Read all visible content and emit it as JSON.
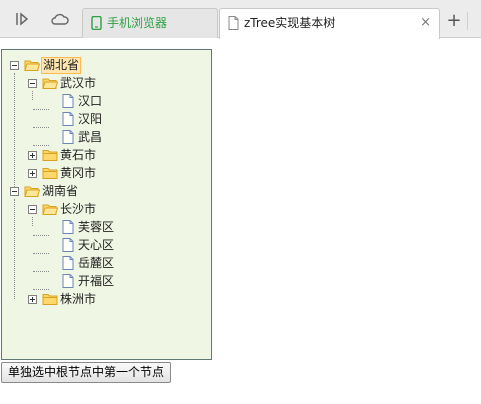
{
  "browser": {
    "tabs": [
      {
        "label": "手机浏览器",
        "icon": "phone-icon",
        "color": "#2ea043"
      },
      {
        "label": "zTree实现基本树",
        "icon": "page-icon",
        "close": "×"
      }
    ],
    "add_tab": "+"
  },
  "tree": {
    "nodes": [
      {
        "label": "湖北省",
        "type": "folder",
        "open": true,
        "selected": true
      },
      {
        "label": "武汉市",
        "type": "folder",
        "open": true
      },
      {
        "label": "汉口",
        "type": "file"
      },
      {
        "label": "汉阳",
        "type": "file"
      },
      {
        "label": "武昌",
        "type": "file"
      },
      {
        "label": "黄石市",
        "type": "folder",
        "open": false
      },
      {
        "label": "黄冈市",
        "type": "folder",
        "open": false
      },
      {
        "label": "湖南省",
        "type": "folder",
        "open": true
      },
      {
        "label": "长沙市",
        "type": "folder",
        "open": true
      },
      {
        "label": "芙蓉区",
        "type": "file"
      },
      {
        "label": "天心区",
        "type": "file"
      },
      {
        "label": "岳麓区",
        "type": "file"
      },
      {
        "label": "开福区",
        "type": "file"
      },
      {
        "label": "株洲市",
        "type": "folder",
        "open": false
      }
    ],
    "colors": {
      "background": "#f0f6e4",
      "border": "#617775",
      "selected": "#ffe6b0"
    }
  },
  "actions": {
    "select_first_root": "单独选中根节点中第一个节点"
  }
}
